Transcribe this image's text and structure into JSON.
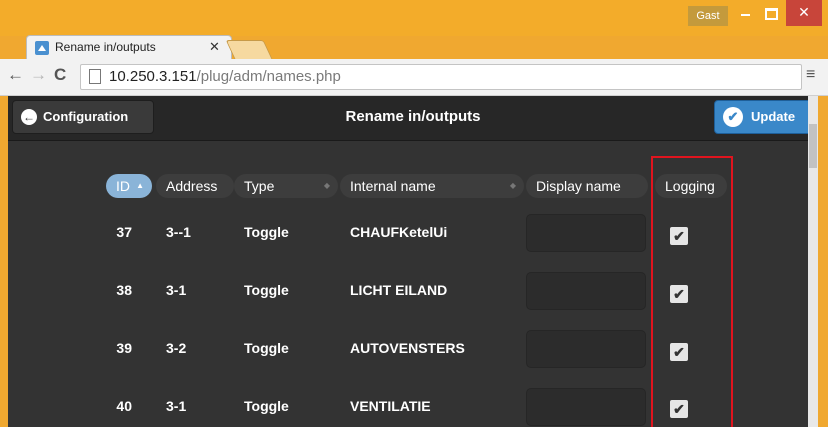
{
  "window": {
    "user": "Gast",
    "min": "_",
    "close": "✕"
  },
  "browser": {
    "tab_title": "Rename in/outputs",
    "tab_close": "✕",
    "url_host": "10.250.3.151",
    "url_path": "/plug/adm/names.php"
  },
  "header": {
    "back_label": "Configuration",
    "title": "Rename in/outputs",
    "update_label": "Update"
  },
  "table": {
    "columns": [
      "ID",
      "Address",
      "Type",
      "Internal name",
      "Display name",
      "Logging"
    ],
    "sorted_column": "ID",
    "rows": [
      {
        "id": "37",
        "address": "3--1",
        "type": "Toggle",
        "internal": "CHAUFKetelUi",
        "display": "",
        "logging": true
      },
      {
        "id": "38",
        "address": "3-1",
        "type": "Toggle",
        "internal": "LICHT EILAND",
        "display": "",
        "logging": true
      },
      {
        "id": "39",
        "address": "3-2",
        "type": "Toggle",
        "internal": "AUTOVENSTERS",
        "display": "",
        "logging": true
      },
      {
        "id": "40",
        "address": "3-1",
        "type": "Toggle",
        "internal": "VENTILATIE",
        "display": "",
        "logging": true
      }
    ]
  },
  "colors": {
    "accent": "#3a88c9",
    "header_bg": "#272727",
    "highlight": "#e0141e",
    "window_frame": "#f3ac2a"
  }
}
